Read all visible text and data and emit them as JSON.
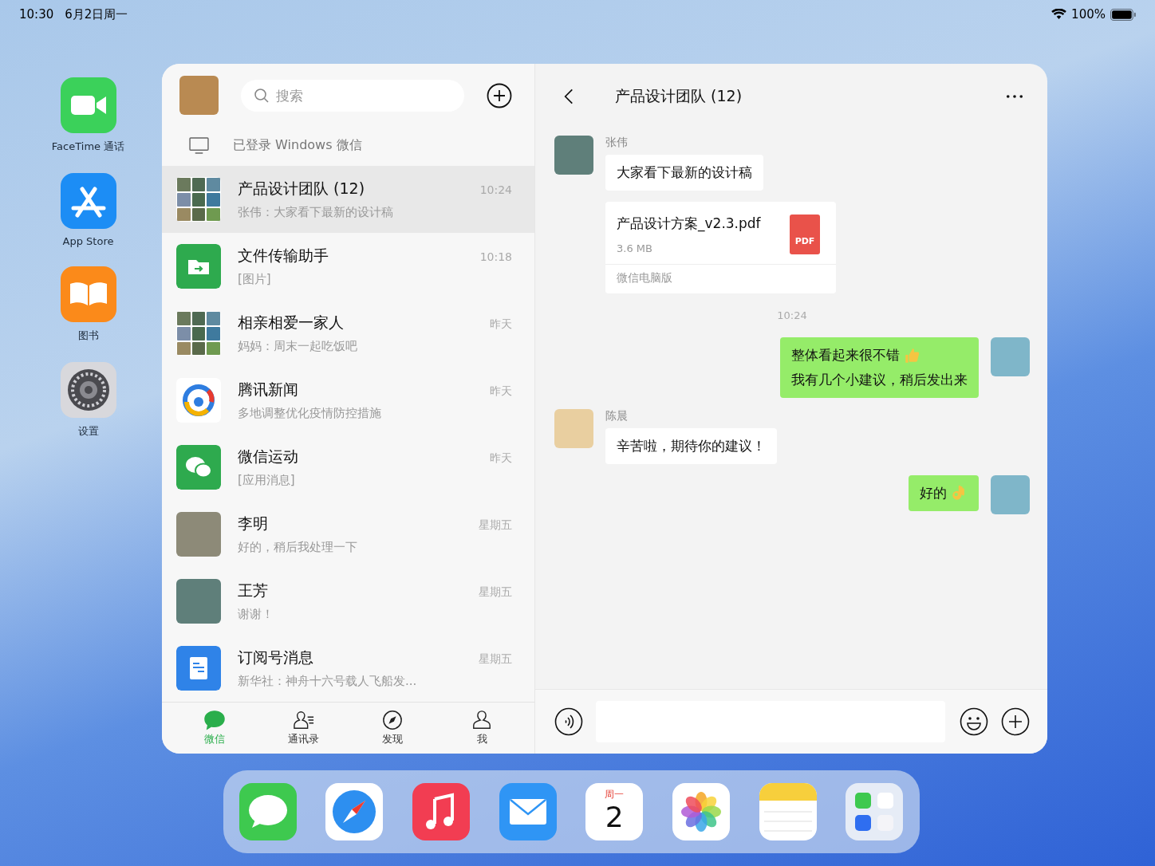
{
  "status_bar": {
    "time": "10:30",
    "date": "6月2日周一",
    "battery": "100%"
  },
  "home_apps": [
    {
      "kind": "facetime",
      "label": "FaceTime 通话"
    },
    {
      "kind": "appstore",
      "label": "App Store"
    },
    {
      "kind": "books",
      "label": "图书"
    },
    {
      "kind": "settings",
      "label": "设置"
    }
  ],
  "sidebar": {
    "search_placeholder": "搜索",
    "login_notice": "已登录 Windows 微信",
    "chats": [
      {
        "avatar": {
          "kind": "group"
        },
        "name": "产品设计团队 (12)",
        "preview": "张伟：大家看下最新的设计稿",
        "time": "10:24",
        "selected": true
      },
      {
        "avatar": {
          "kind": "file-transfer"
        },
        "name": "文件传输助手",
        "preview": "[图片]",
        "time": "10:18",
        "selected": false
      },
      {
        "avatar": {
          "kind": "group"
        },
        "name": "相亲相爱一家人",
        "preview": "妈妈：周末一起吃饭吧",
        "time": "昨天",
        "selected": false
      },
      {
        "avatar": {
          "kind": "news"
        },
        "name": "腾讯新闻",
        "preview": "多地调整优化疫情防控措施",
        "time": "昨天",
        "selected": false
      },
      {
        "avatar": {
          "kind": "sport"
        },
        "name": "微信运动",
        "preview": "[应用消息]",
        "time": "昨天",
        "selected": false
      },
      {
        "avatar": {
          "kind": "dog"
        },
        "name": "李明",
        "preview": "好的，稍后我处理一下",
        "time": "星期五",
        "selected": false
      },
      {
        "avatar": {
          "kind": "landscape"
        },
        "name": "王芳",
        "preview": "谢谢！",
        "time": "星期五",
        "selected": false
      },
      {
        "avatar": {
          "kind": "subscription"
        },
        "name": "订阅号消息",
        "preview": "新华社：神舟十六号载人飞船发...",
        "time": "星期五",
        "selected": false
      }
    ],
    "tabs": [
      {
        "kind": "chats",
        "label": "微信",
        "selected": true
      },
      {
        "kind": "contacts",
        "label": "通讯录",
        "selected": false
      },
      {
        "kind": "discover",
        "label": "发现",
        "selected": false
      },
      {
        "kind": "me",
        "label": "我",
        "selected": false
      }
    ]
  },
  "chat": {
    "title": "产品设计团队 (12)",
    "messages": [
      {
        "kind": "incoming",
        "avatar": {
          "kind": "landscape"
        },
        "sender": "张伟",
        "text": "大家看下最新的设计稿"
      },
      {
        "kind": "file",
        "file_name": "产品设计方案_v2.3.pdf",
        "file_size": "3.6 MB",
        "file_type": "PDF",
        "source": "微信电脑版"
      },
      {
        "kind": "time",
        "text": "10:24"
      },
      {
        "kind": "outgoing",
        "avatar": {
          "kind": "beach"
        },
        "lines": [
          "整体看起来很不错",
          "我有几个小建议，稍后发出来"
        ],
        "emoji": {
          "kind": "thumbs-up"
        }
      },
      {
        "kind": "incoming",
        "avatar": {
          "kind": "cartoon-dog"
        },
        "sender": "陈晨",
        "text": "辛苦啦，期待你的建议！"
      },
      {
        "kind": "outgoing",
        "avatar": {
          "kind": "beach"
        },
        "text": "好的",
        "emoji": {
          "kind": "ok-hand"
        }
      }
    ]
  },
  "dock": [
    {
      "kind": "messages"
    },
    {
      "kind": "safari"
    },
    {
      "kind": "music"
    },
    {
      "kind": "mail"
    },
    {
      "kind": "calendar",
      "weekday": "周一",
      "day": "2"
    },
    {
      "kind": "photos"
    },
    {
      "kind": "notes"
    },
    {
      "kind": "folder"
    }
  ]
}
